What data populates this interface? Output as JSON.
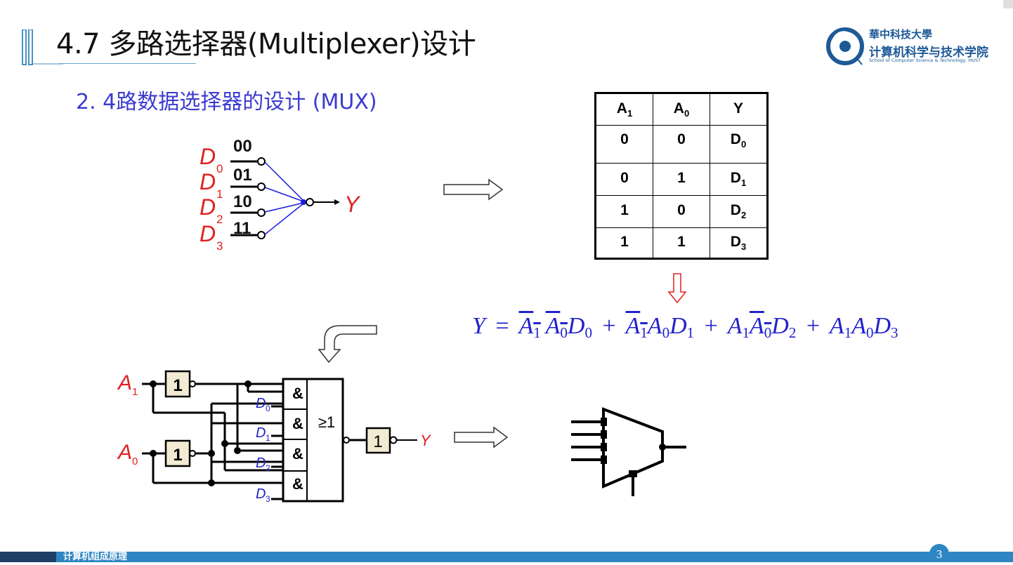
{
  "slide": {
    "title": "4.7 多路选择器(Multiplexer)设计",
    "subtitle": "2. 4路数据选择器的设计 (MUX)",
    "footer_text": "计算机组成原理",
    "page_number": "3"
  },
  "logo": {
    "line1": "華中科技大學",
    "line2": "计算机科学与技术学院",
    "line3": "School of Computer Science & Technology, HUST"
  },
  "switch_diagram": {
    "inputs": [
      {
        "name": "D",
        "sub": "0",
        "code": "00"
      },
      {
        "name": "D",
        "sub": "1",
        "code": "01"
      },
      {
        "name": "D",
        "sub": "2",
        "code": "10"
      },
      {
        "name": "D",
        "sub": "3",
        "code": "11"
      }
    ],
    "output": "Y"
  },
  "truth_table": {
    "headers": [
      {
        "main": "A",
        "sub": "1"
      },
      {
        "main": "A",
        "sub": "0"
      },
      {
        "main": "Y",
        "sub": ""
      }
    ],
    "rows": [
      [
        {
          "main": "0",
          "sub": ""
        },
        {
          "main": "0",
          "sub": ""
        },
        {
          "main": "D",
          "sub": "0"
        }
      ],
      [
        {
          "main": "0",
          "sub": ""
        },
        {
          "main": "1",
          "sub": ""
        },
        {
          "main": "D",
          "sub": "1"
        }
      ],
      [
        {
          "main": "1",
          "sub": ""
        },
        {
          "main": "0",
          "sub": ""
        },
        {
          "main": "D",
          "sub": "2"
        }
      ],
      [
        {
          "main": "1",
          "sub": ""
        },
        {
          "main": "1",
          "sub": ""
        },
        {
          "main": "D",
          "sub": "3"
        }
      ]
    ]
  },
  "formula": {
    "lhs": "Y",
    "eq": "=",
    "plus": "+",
    "terms": [
      [
        {
          "v": "A",
          "s": "1",
          "bar": true
        },
        {
          "v": "A",
          "s": "0",
          "bar": true
        },
        {
          "v": "D",
          "s": "0",
          "bar": false
        }
      ],
      [
        {
          "v": "A",
          "s": "1",
          "bar": true
        },
        {
          "v": "A",
          "s": "0",
          "bar": false
        },
        {
          "v": "D",
          "s": "1",
          "bar": false
        }
      ],
      [
        {
          "v": "A",
          "s": "1",
          "bar": false
        },
        {
          "v": "A",
          "s": "0",
          "bar": true
        },
        {
          "v": "D",
          "s": "2",
          "bar": false
        }
      ],
      [
        {
          "v": "A",
          "s": "1",
          "bar": false
        },
        {
          "v": "A",
          "s": "0",
          "bar": false
        },
        {
          "v": "D",
          "s": "3",
          "bar": false
        }
      ]
    ]
  },
  "gate_circuit": {
    "select_inputs": [
      {
        "name": "A",
        "sub": "1"
      },
      {
        "name": "A",
        "sub": "0"
      }
    ],
    "data_inputs": [
      {
        "name": "D",
        "sub": "0"
      },
      {
        "name": "D",
        "sub": "1"
      },
      {
        "name": "D",
        "sub": "2"
      },
      {
        "name": "D",
        "sub": "3"
      }
    ],
    "inverter_label": "1",
    "and_label": "&",
    "or_label": "≥1",
    "output": "Y"
  },
  "colors": {
    "title": "#111111",
    "subtitle": "#3b3bd0",
    "red_label": "#e02020",
    "blue_label": "#2222cc",
    "footer_bar": "#2f86c2",
    "footer_dark": "#1f3f64",
    "logo": "#1d5a96",
    "gate_fill": "#f2ead2"
  }
}
